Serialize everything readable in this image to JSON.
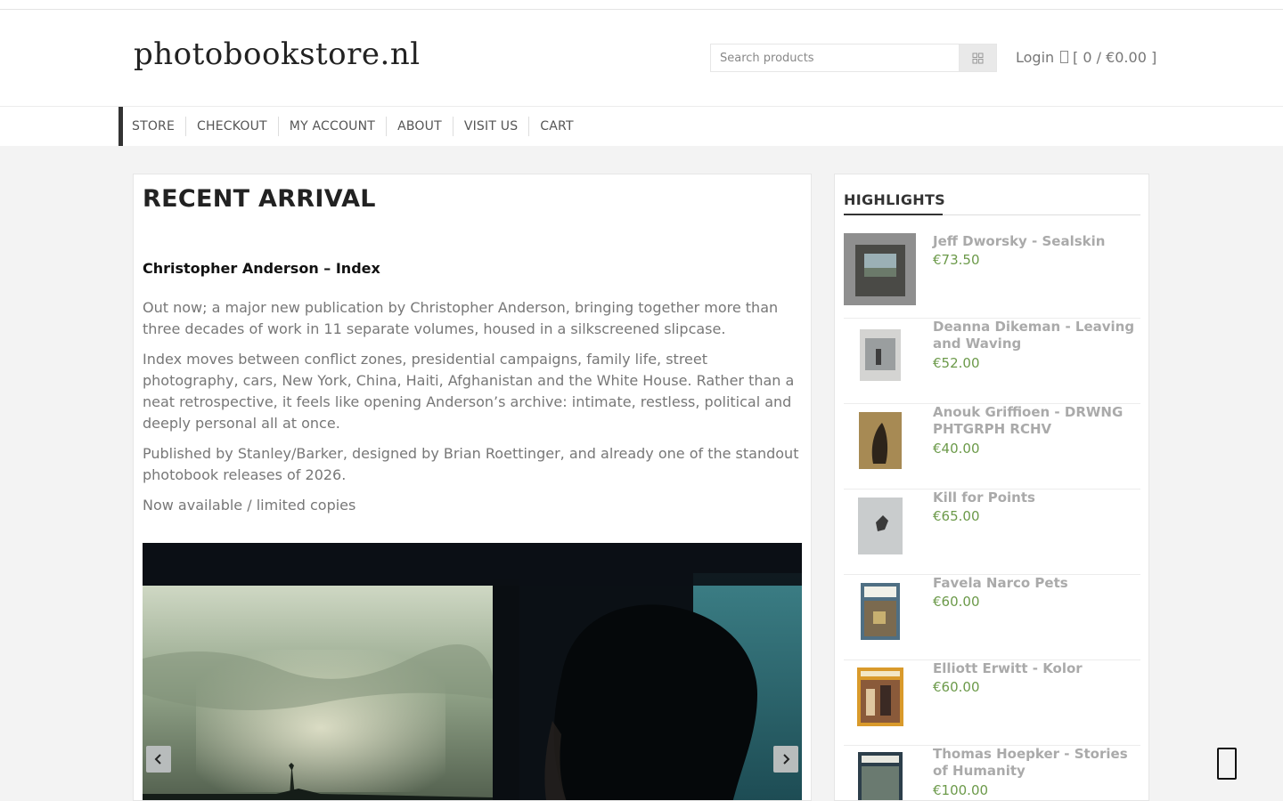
{
  "header": {
    "logo": "photobookstore.nl",
    "search_placeholder": "Search products",
    "login_label": "Login",
    "cart_summary": "[ 0 / €0.00 ]"
  },
  "nav": {
    "items": [
      "STORE",
      "CHECKOUT",
      "MY ACCOUNT",
      "ABOUT",
      "VISIT US",
      "CART"
    ]
  },
  "main": {
    "heading": "RECENT ARRIVAL",
    "post_title": "Christopher Anderson – Index",
    "paragraphs": [
      "Out now; a major new publication by Christopher Anderson, bringing together more than three decades of work in 11 separate volumes, housed in a silkscreened slipcase.",
      "Index moves between conflict zones, presidential campaigns, family life, street photography, cars, New York, China, Haiti, Afghanistan and the White House. Rather than a neat retrospective, it feels like opening Anderson’s archive: intimate, restless, political and deeply personal all at once.",
      "Published by Stanley/Barker, designed by Brian Roettinger, and already one of the standout photobook releases of 2026.",
      "Now available / limited copies"
    ]
  },
  "sidebar": {
    "heading": "HIGHLIGHTS",
    "items": [
      {
        "name": "Jeff Dworsky - Sealskin",
        "price": "€73.50"
      },
      {
        "name": "Deanna Dikeman - Leaving and Waving",
        "price": "€52.00"
      },
      {
        "name": "Anouk Griffioen - DRWNG PHTGRPH RCHV",
        "price": "€40.00"
      },
      {
        "name": "Kill for Points",
        "price": "€65.00"
      },
      {
        "name": "Favela Narco Pets",
        "price": "€60.00"
      },
      {
        "name": "Elliott Erwitt - Kolor",
        "price": "€60.00"
      },
      {
        "name": "Thomas Hoepker - Stories of Humanity",
        "price": "€100.00"
      }
    ]
  },
  "colors": {
    "price": "#6c9a4a",
    "product_name": "#aaaaaa",
    "nav_indicator": "#333333"
  }
}
